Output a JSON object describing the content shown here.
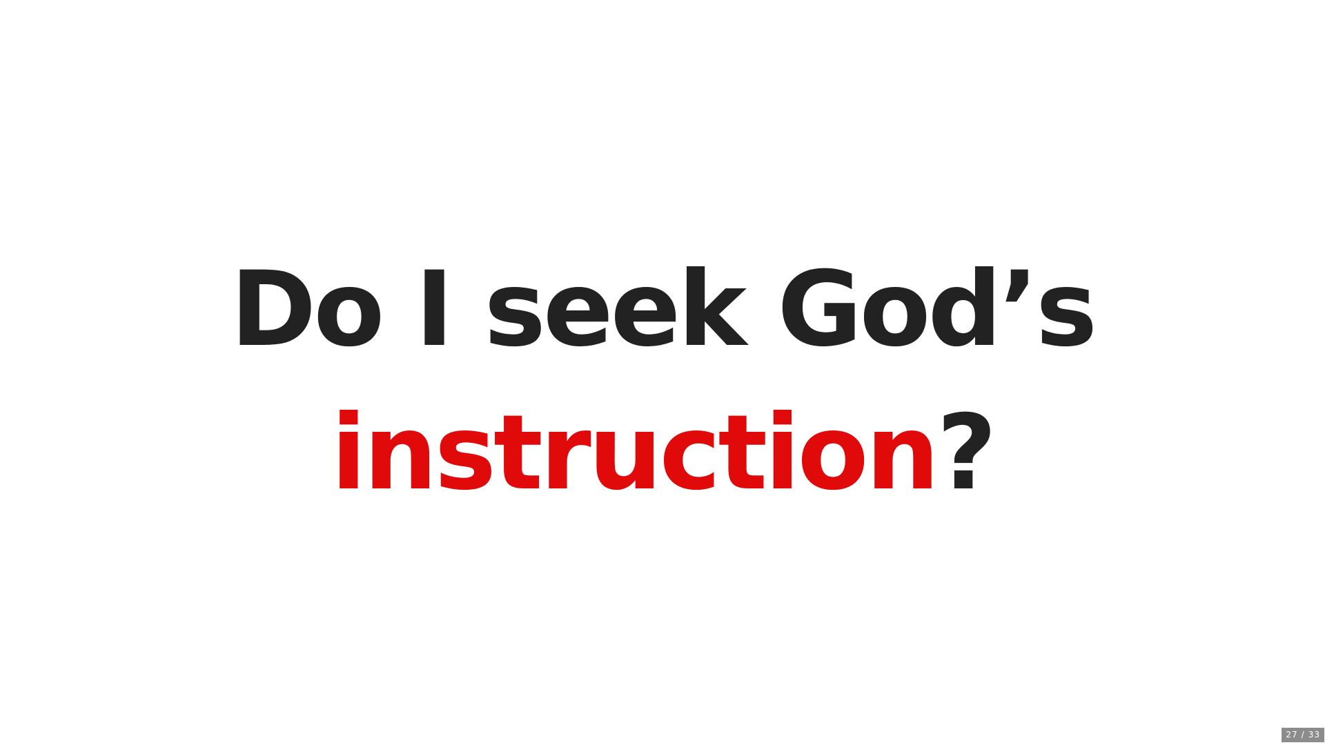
{
  "slide": {
    "line1": "Do I seek God’s",
    "line2_highlight": "instruction",
    "line2_suffix": "?",
    "highlight_color": "#e10a0a",
    "text_color": "#222222"
  },
  "pagination": {
    "current": "27",
    "separator": "/",
    "total": "33"
  }
}
